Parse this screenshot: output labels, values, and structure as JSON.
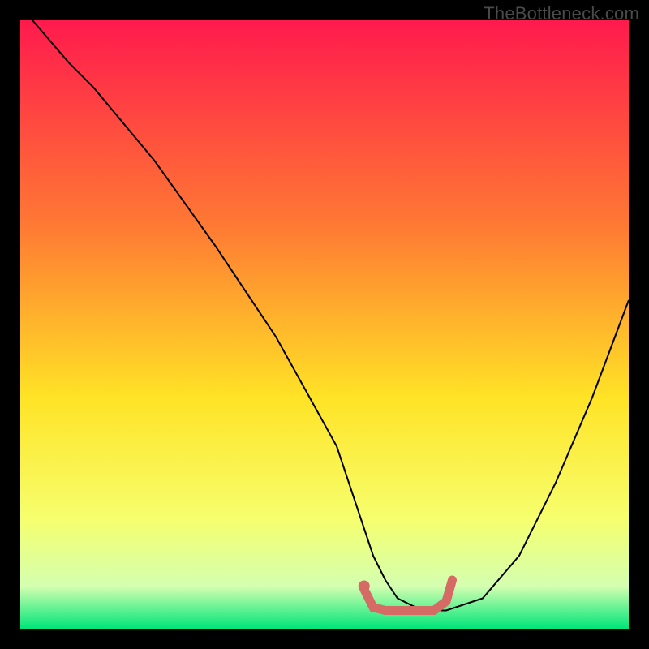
{
  "watermark": "TheBottleneck.com",
  "chart_data": {
    "type": "line",
    "title": "",
    "xlabel": "",
    "ylabel": "",
    "xlim": [
      0,
      100
    ],
    "ylim": [
      0,
      100
    ],
    "background_gradient": {
      "top": "#ff1a4d",
      "mid1": "#ff7a33",
      "mid2": "#ffe326",
      "mid3": "#f6ff6e",
      "mid4": "#d4ffb0",
      "bottom": "#00e57a"
    },
    "series": [
      {
        "name": "bottleneck-curve",
        "color": "#000000",
        "width": 2,
        "x": [
          2,
          8,
          12,
          22,
          32,
          42,
          52,
          56,
          58,
          60,
          62,
          66,
          70,
          76,
          82,
          88,
          94,
          100
        ],
        "y": [
          100,
          93,
          89,
          77,
          63,
          48,
          30,
          18,
          12,
          8,
          5,
          3,
          3,
          5,
          12,
          24,
          38,
          54
        ]
      },
      {
        "name": "optimal-range-highlight",
        "color": "#d66a64",
        "width": 11,
        "linecap": "round",
        "x": [
          56.5,
          58,
          60,
          64,
          68,
          70,
          71
        ],
        "y": [
          6.5,
          3.5,
          3,
          3,
          3,
          4.5,
          8
        ]
      }
    ],
    "points": [
      {
        "name": "marker-dot",
        "x": 56.5,
        "y": 7,
        "r": 7,
        "color": "#d66a64"
      }
    ]
  }
}
